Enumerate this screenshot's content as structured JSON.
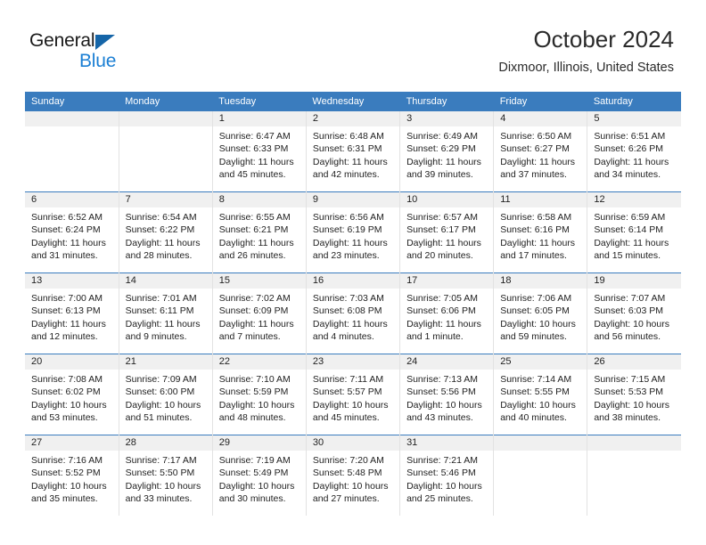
{
  "brand": {
    "name_top": "General",
    "name_bottom": "Blue",
    "accent_color": "#1b7fd4",
    "header_color": "#3a7cbe"
  },
  "header": {
    "title": "October 2024",
    "subtitle": "Dixmoor, Illinois, United States"
  },
  "calendar": {
    "weekday_headers": [
      "Sunday",
      "Monday",
      "Tuesday",
      "Wednesday",
      "Thursday",
      "Friday",
      "Saturday"
    ],
    "weeks": [
      [
        {
          "day": "",
          "empty": true
        },
        {
          "day": "",
          "empty": true
        },
        {
          "day": "1",
          "sunrise": "Sunrise: 6:47 AM",
          "sunset": "Sunset: 6:33 PM",
          "daylight1": "Daylight: 11 hours",
          "daylight2": "and 45 minutes."
        },
        {
          "day": "2",
          "sunrise": "Sunrise: 6:48 AM",
          "sunset": "Sunset: 6:31 PM",
          "daylight1": "Daylight: 11 hours",
          "daylight2": "and 42 minutes."
        },
        {
          "day": "3",
          "sunrise": "Sunrise: 6:49 AM",
          "sunset": "Sunset: 6:29 PM",
          "daylight1": "Daylight: 11 hours",
          "daylight2": "and 39 minutes."
        },
        {
          "day": "4",
          "sunrise": "Sunrise: 6:50 AM",
          "sunset": "Sunset: 6:27 PM",
          "daylight1": "Daylight: 11 hours",
          "daylight2": "and 37 minutes."
        },
        {
          "day": "5",
          "sunrise": "Sunrise: 6:51 AM",
          "sunset": "Sunset: 6:26 PM",
          "daylight1": "Daylight: 11 hours",
          "daylight2": "and 34 minutes."
        }
      ],
      [
        {
          "day": "6",
          "sunrise": "Sunrise: 6:52 AM",
          "sunset": "Sunset: 6:24 PM",
          "daylight1": "Daylight: 11 hours",
          "daylight2": "and 31 minutes."
        },
        {
          "day": "7",
          "sunrise": "Sunrise: 6:54 AM",
          "sunset": "Sunset: 6:22 PM",
          "daylight1": "Daylight: 11 hours",
          "daylight2": "and 28 minutes."
        },
        {
          "day": "8",
          "sunrise": "Sunrise: 6:55 AM",
          "sunset": "Sunset: 6:21 PM",
          "daylight1": "Daylight: 11 hours",
          "daylight2": "and 26 minutes."
        },
        {
          "day": "9",
          "sunrise": "Sunrise: 6:56 AM",
          "sunset": "Sunset: 6:19 PM",
          "daylight1": "Daylight: 11 hours",
          "daylight2": "and 23 minutes."
        },
        {
          "day": "10",
          "sunrise": "Sunrise: 6:57 AM",
          "sunset": "Sunset: 6:17 PM",
          "daylight1": "Daylight: 11 hours",
          "daylight2": "and 20 minutes."
        },
        {
          "day": "11",
          "sunrise": "Sunrise: 6:58 AM",
          "sunset": "Sunset: 6:16 PM",
          "daylight1": "Daylight: 11 hours",
          "daylight2": "and 17 minutes."
        },
        {
          "day": "12",
          "sunrise": "Sunrise: 6:59 AM",
          "sunset": "Sunset: 6:14 PM",
          "daylight1": "Daylight: 11 hours",
          "daylight2": "and 15 minutes."
        }
      ],
      [
        {
          "day": "13",
          "sunrise": "Sunrise: 7:00 AM",
          "sunset": "Sunset: 6:13 PM",
          "daylight1": "Daylight: 11 hours",
          "daylight2": "and 12 minutes."
        },
        {
          "day": "14",
          "sunrise": "Sunrise: 7:01 AM",
          "sunset": "Sunset: 6:11 PM",
          "daylight1": "Daylight: 11 hours",
          "daylight2": "and 9 minutes."
        },
        {
          "day": "15",
          "sunrise": "Sunrise: 7:02 AM",
          "sunset": "Sunset: 6:09 PM",
          "daylight1": "Daylight: 11 hours",
          "daylight2": "and 7 minutes."
        },
        {
          "day": "16",
          "sunrise": "Sunrise: 7:03 AM",
          "sunset": "Sunset: 6:08 PM",
          "daylight1": "Daylight: 11 hours",
          "daylight2": "and 4 minutes."
        },
        {
          "day": "17",
          "sunrise": "Sunrise: 7:05 AM",
          "sunset": "Sunset: 6:06 PM",
          "daylight1": "Daylight: 11 hours",
          "daylight2": "and 1 minute."
        },
        {
          "day": "18",
          "sunrise": "Sunrise: 7:06 AM",
          "sunset": "Sunset: 6:05 PM",
          "daylight1": "Daylight: 10 hours",
          "daylight2": "and 59 minutes."
        },
        {
          "day": "19",
          "sunrise": "Sunrise: 7:07 AM",
          "sunset": "Sunset: 6:03 PM",
          "daylight1": "Daylight: 10 hours",
          "daylight2": "and 56 minutes."
        }
      ],
      [
        {
          "day": "20",
          "sunrise": "Sunrise: 7:08 AM",
          "sunset": "Sunset: 6:02 PM",
          "daylight1": "Daylight: 10 hours",
          "daylight2": "and 53 minutes."
        },
        {
          "day": "21",
          "sunrise": "Sunrise: 7:09 AM",
          "sunset": "Sunset: 6:00 PM",
          "daylight1": "Daylight: 10 hours",
          "daylight2": "and 51 minutes."
        },
        {
          "day": "22",
          "sunrise": "Sunrise: 7:10 AM",
          "sunset": "Sunset: 5:59 PM",
          "daylight1": "Daylight: 10 hours",
          "daylight2": "and 48 minutes."
        },
        {
          "day": "23",
          "sunrise": "Sunrise: 7:11 AM",
          "sunset": "Sunset: 5:57 PM",
          "daylight1": "Daylight: 10 hours",
          "daylight2": "and 45 minutes."
        },
        {
          "day": "24",
          "sunrise": "Sunrise: 7:13 AM",
          "sunset": "Sunset: 5:56 PM",
          "daylight1": "Daylight: 10 hours",
          "daylight2": "and 43 minutes."
        },
        {
          "day": "25",
          "sunrise": "Sunrise: 7:14 AM",
          "sunset": "Sunset: 5:55 PM",
          "daylight1": "Daylight: 10 hours",
          "daylight2": "and 40 minutes."
        },
        {
          "day": "26",
          "sunrise": "Sunrise: 7:15 AM",
          "sunset": "Sunset: 5:53 PM",
          "daylight1": "Daylight: 10 hours",
          "daylight2": "and 38 minutes."
        }
      ],
      [
        {
          "day": "27",
          "sunrise": "Sunrise: 7:16 AM",
          "sunset": "Sunset: 5:52 PM",
          "daylight1": "Daylight: 10 hours",
          "daylight2": "and 35 minutes."
        },
        {
          "day": "28",
          "sunrise": "Sunrise: 7:17 AM",
          "sunset": "Sunset: 5:50 PM",
          "daylight1": "Daylight: 10 hours",
          "daylight2": "and 33 minutes."
        },
        {
          "day": "29",
          "sunrise": "Sunrise: 7:19 AM",
          "sunset": "Sunset: 5:49 PM",
          "daylight1": "Daylight: 10 hours",
          "daylight2": "and 30 minutes."
        },
        {
          "day": "30",
          "sunrise": "Sunrise: 7:20 AM",
          "sunset": "Sunset: 5:48 PM",
          "daylight1": "Daylight: 10 hours",
          "daylight2": "and 27 minutes."
        },
        {
          "day": "31",
          "sunrise": "Sunrise: 7:21 AM",
          "sunset": "Sunset: 5:46 PM",
          "daylight1": "Daylight: 10 hours",
          "daylight2": "and 25 minutes."
        },
        {
          "day": "",
          "empty": true
        },
        {
          "day": "",
          "empty": true
        }
      ]
    ]
  }
}
